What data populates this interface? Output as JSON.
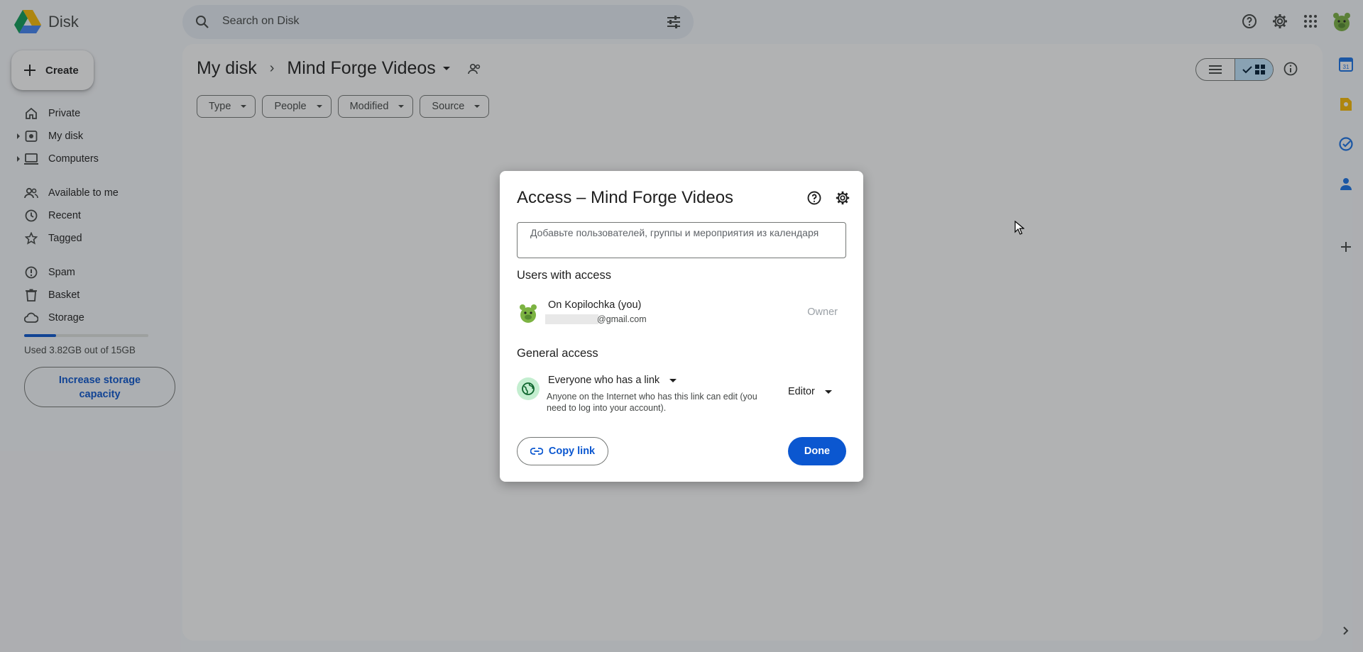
{
  "app": {
    "name": "Disk"
  },
  "search": {
    "placeholder": "Search on Disk"
  },
  "sidebar": {
    "create_label": "Create",
    "items": [
      {
        "label": "Private"
      },
      {
        "label": "My disk"
      },
      {
        "label": "Computers"
      },
      {
        "label": "Available to me"
      },
      {
        "label": "Recent"
      },
      {
        "label": "Tagged"
      },
      {
        "label": "Spam"
      },
      {
        "label": "Basket"
      },
      {
        "label": "Storage"
      }
    ],
    "storage": {
      "text": "Used 3.82GB out of 15GB",
      "fraction": 0.255
    },
    "increase_label": "Increase storage capacity"
  },
  "breadcrumb": {
    "root": "My disk",
    "current": "Mind Forge Videos"
  },
  "filters": [
    "Type",
    "People",
    "Modified",
    "Source"
  ],
  "dialog": {
    "title": "Access – Mind Forge Videos",
    "add_placeholder": "Добавьте пользователей, группы и мероприятия из календаря",
    "users_heading": "Users with access",
    "user": {
      "name": "On Kopilochka (you)",
      "email": "@gmail.com",
      "role": "Owner"
    },
    "general_heading": "General access",
    "general": {
      "link_setting": "Everyone who has a link",
      "description": "Anyone on the Internet who has this link can edit (you need to log into your account).",
      "role": "Editor"
    },
    "copy_label": "Copy link",
    "done_label": "Done"
  },
  "colors": {
    "accent": "#0b57d0",
    "selected_view": "#c2e7ff"
  }
}
